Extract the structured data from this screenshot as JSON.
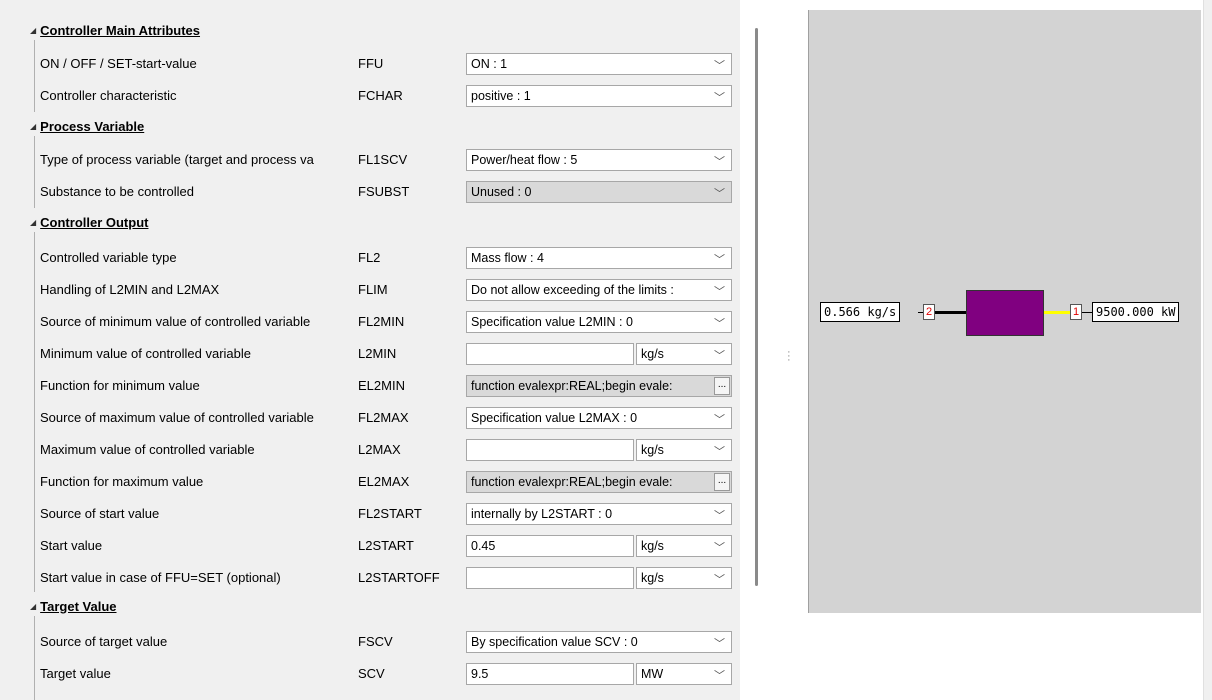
{
  "sections": {
    "main": "Controller Main Attributes",
    "process": "Process Variable",
    "output": "Controller Output",
    "target": "Target Value"
  },
  "rows": [
    {
      "label": "ON / OFF / SET-start-value",
      "code": "FFU",
      "value": "ON : 1"
    },
    {
      "label": "Controller characteristic",
      "code": "FCHAR",
      "value": "positive : 1"
    },
    {
      "label": "Type of process variable (target and process va",
      "code": "FL1SCV",
      "value": "Power/heat flow : 5"
    },
    {
      "label": "Substance to be controlled",
      "code": "FSUBST",
      "value": "Unused : 0"
    },
    {
      "label": "Controlled variable type",
      "code": "FL2",
      "value": "Mass flow : 4"
    },
    {
      "label": "Handling of L2MIN and L2MAX",
      "code": "FLIM",
      "value": "Do not allow exceeding of the limits :"
    },
    {
      "label": "Source of minimum value of controlled variable",
      "code": "FL2MIN",
      "value": "Specification value L2MIN : 0"
    },
    {
      "label": "Minimum value of controlled variable",
      "code": "L2MIN",
      "value": "",
      "unit": "kg/s"
    },
    {
      "label": "Function for minimum value",
      "code": "EL2MIN",
      "value": "function evalexpr:REAL;begin   evale:"
    },
    {
      "label": "Source of maximum value of controlled variable",
      "code": "FL2MAX",
      "value": "Specification value L2MAX : 0"
    },
    {
      "label": "Maximum value of controlled variable",
      "code": "L2MAX",
      "value": "",
      "unit": "kg/s"
    },
    {
      "label": "Function for maximum value",
      "code": "EL2MAX",
      "value": "function evalexpr:REAL;begin   evale:"
    },
    {
      "label": "Source of start value",
      "code": "FL2START",
      "value": "internally by L2START : 0"
    },
    {
      "label": "Start value",
      "code": "L2START",
      "value": "0.45",
      "unit": "kg/s"
    },
    {
      "label": "Start value in case of FFU=SET (optional)",
      "code": "L2STARTOFF",
      "value": "",
      "unit": "kg/s"
    },
    {
      "label": "Source of target value",
      "code": "FSCV",
      "value": "By specification value SCV : 0"
    },
    {
      "label": "Target value",
      "code": "SCV",
      "value": "9.5",
      "unit": "MW"
    }
  ],
  "ellipsis": "...",
  "diagram": {
    "left_value": "0.566 kg/s",
    "left_port": "2",
    "right_port": "1",
    "right_value": "9500.000 kW",
    "component_color": "#800080",
    "right_line_color": "#ffff00"
  },
  "icons": {
    "chevron": "chevron-down-icon",
    "collapse": "triangle-collapse-icon"
  }
}
